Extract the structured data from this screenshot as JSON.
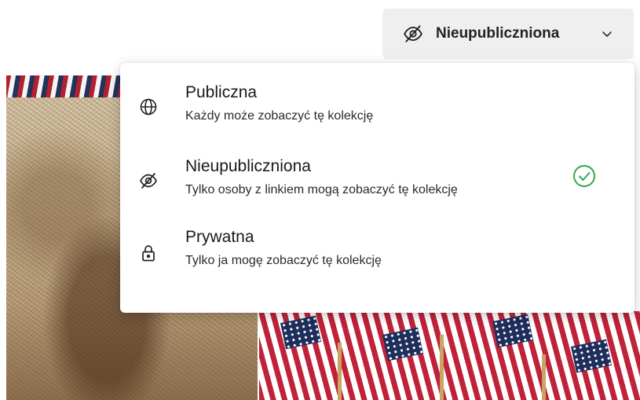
{
  "visibility_button": {
    "label": "Nieupubliczniona",
    "icon": "eye-slash-icon",
    "dropdown_icon": "chevron-down-icon"
  },
  "menu": {
    "items": [
      {
        "title": "Publiczna",
        "description": "Każdy może zobaczyć tę kolekcję",
        "icon": "globe-icon",
        "selected": false
      },
      {
        "title": "Nieupubliczniona",
        "description": "Tylko osoby z linkiem mogą zobaczyć tę kolekcję",
        "icon": "eye-slash-icon",
        "selected": true
      },
      {
        "title": "Prywatna",
        "description": "Tylko ja mogę zobaczyć tę kolekcję",
        "icon": "lock-icon",
        "selected": false
      }
    ],
    "selected_check_icon": "check-circle-icon"
  },
  "colors": {
    "accent_check": "#2fa84f",
    "button_bg": "#efefef",
    "text": "#1a1a1a"
  }
}
